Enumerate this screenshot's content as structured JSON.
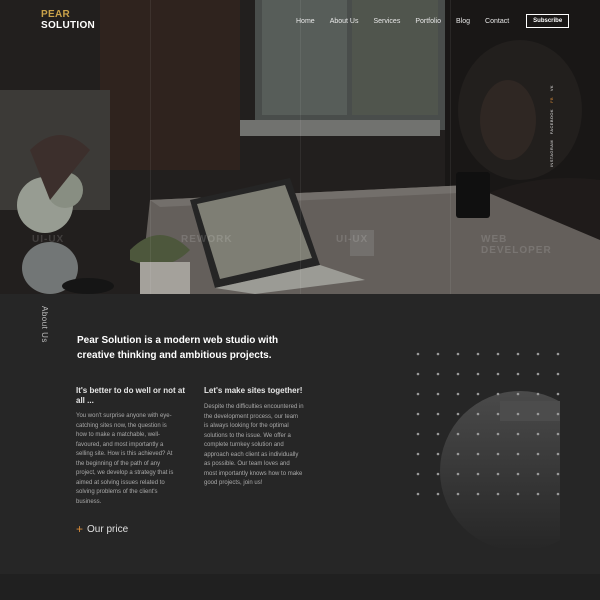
{
  "brand": {
    "line1": "PEAR",
    "line2": "SOLUTION",
    "accent": "#c9a24a"
  },
  "nav": {
    "items": [
      "Home",
      "About Us",
      "Services",
      "Portfolio",
      "Blog",
      "Contact"
    ],
    "subscribe": "Subscribe"
  },
  "social": {
    "items": [
      "VK",
      "FB",
      "FACEBOOK",
      "INSTAGRAM"
    ],
    "accent": "#d88c3a"
  },
  "hero": {
    "words": [
      "UI-UX",
      "REWORK",
      "UI-UX",
      "WEB DEVELOPER"
    ]
  },
  "about": {
    "vertical_label": "About Us",
    "headline": "Pear Solution is a modern web studio with creative thinking and ambitious projects.",
    "col1": {
      "title": "It's better to do well or not at all ...",
      "text": "You won't surprise anyone with eye-catching sites now, the question is how to make a matchable, well-favoured, and most importantly a selling site. How is this achieved? At the beginning of the path of any project, we develop a strategy that is aimed at solving issues related to solving problems of the client's business."
    },
    "col2": {
      "title": "Let's make sites together!",
      "text": "Despite the difficulties encountered in the development process, our team is always looking for the optimal solutions to the issue. We offer a complete turnkey solution and approach each client as individually as possible. Our team loves and most importantly knows how to make good projects, join us!"
    },
    "price_label": "Our price",
    "accent": "#d88c3a"
  },
  "icons": [
    "plus-icon"
  ]
}
